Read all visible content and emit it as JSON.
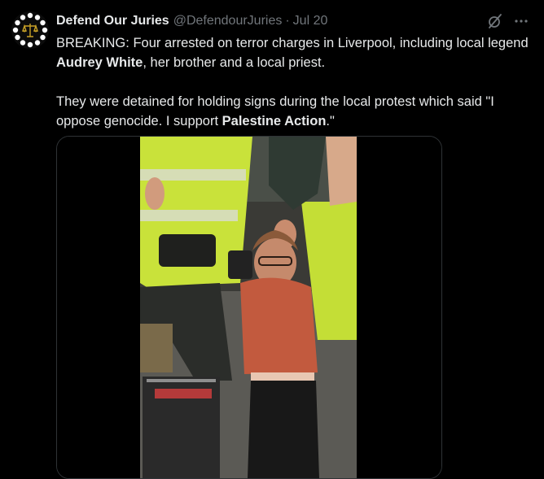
{
  "tweet": {
    "author_name": "Defend Our Juries",
    "handle": "@DefendourJuries",
    "separator": "·",
    "date": "Jul 20",
    "text": {
      "p1_a": "BREAKING: Four arrested on terror charges in Liverpool, including local legend ",
      "p1_b": "Audrey White",
      "p1_c": ", her brother and a local priest.",
      "p2_a": "They were detained for holding signs during the local protest which said \"I oppose genocide. I support ",
      "p2_b": "Palestine Action",
      "p2_c": ".\""
    },
    "media": {
      "type": "video",
      "description_icon": "video-frame"
    }
  },
  "icons": {
    "grok": "grok-icon",
    "more": "more-icon",
    "avatar_logo": "scales-of-justice-icon"
  },
  "colors": {
    "background": "#000000",
    "text": "#e7e9ea",
    "muted": "#71767b",
    "border": "#2f3336",
    "logo_gold": "#c9a227"
  }
}
